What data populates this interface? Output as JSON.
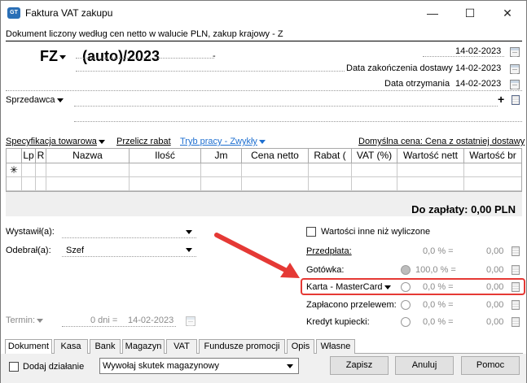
{
  "window": {
    "title": "Faktura VAT zakupu",
    "subheader": "Dokument liczony według cen netto w walucie PLN, zakup krajowy - Z"
  },
  "header": {
    "doc_type": "FZ",
    "number": "(auto)/2023",
    "dash": "-",
    "date1": "14-02-2023",
    "delivery_label": "Data zakończenia dostawy",
    "delivery_date": "14-02-2023",
    "received_label": "Data otrzymania",
    "received_date": "14-02-2023",
    "seller_label": "Sprzedawca",
    "plus": "+"
  },
  "toolbar": {
    "spec": "Specyfikacja towarowa",
    "recalc": "Przelicz rabat",
    "mode": "Tryb pracy - Zwykły",
    "default_price": "Domyślna cena: Cena z ostatniej dostawy"
  },
  "grid": {
    "columns": [
      "Lp",
      "R",
      "Nazwa",
      "Ilość",
      "Jm",
      "Cena netto",
      "Rabat (",
      "VAT (%)",
      "Wartość nett",
      "Wartość br"
    ],
    "new_row_marker": "✳"
  },
  "summary": {
    "to_pay": "Do zapłaty: 0,00 PLN"
  },
  "left": {
    "issued_label": "Wystawił(a):",
    "received_label": "Odebrał(a):",
    "received_value": "Szef",
    "term_label": "Termin:",
    "term_days": "0 dni =",
    "term_date": "14-02-2023"
  },
  "payments": {
    "other_values": "Wartości inne niż wyliczone",
    "rows": [
      {
        "label": "Przedpłata:",
        "pct": "0,0 % =",
        "amount": "0,00"
      },
      {
        "label": "Gotówka:",
        "pct": "100,0 % =",
        "amount": "0,00"
      },
      {
        "label": "Karta - MasterCard",
        "pct": "0,0 % =",
        "amount": "0,00"
      },
      {
        "label": "Zapłacono przelewem:",
        "pct": "0,0 % =",
        "amount": "0,00"
      },
      {
        "label": "Kredyt kupiecki:",
        "pct": "0,0 % =",
        "amount": "0,00"
      }
    ]
  },
  "tabs": [
    "Dokument",
    "Kasa",
    "Bank",
    "Magazyn",
    "VAT",
    "Fundusze promocji",
    "Opis",
    "Własne"
  ],
  "footer": {
    "add_action": "Dodaj działanie",
    "action_select": "Wywołaj skutek magazynowy",
    "save": "Zapisz",
    "cancel": "Anuluj",
    "help": "Pomoc"
  },
  "colors": {
    "accent_blue": "#1e6fd0",
    "annotation_red": "#e53935"
  }
}
